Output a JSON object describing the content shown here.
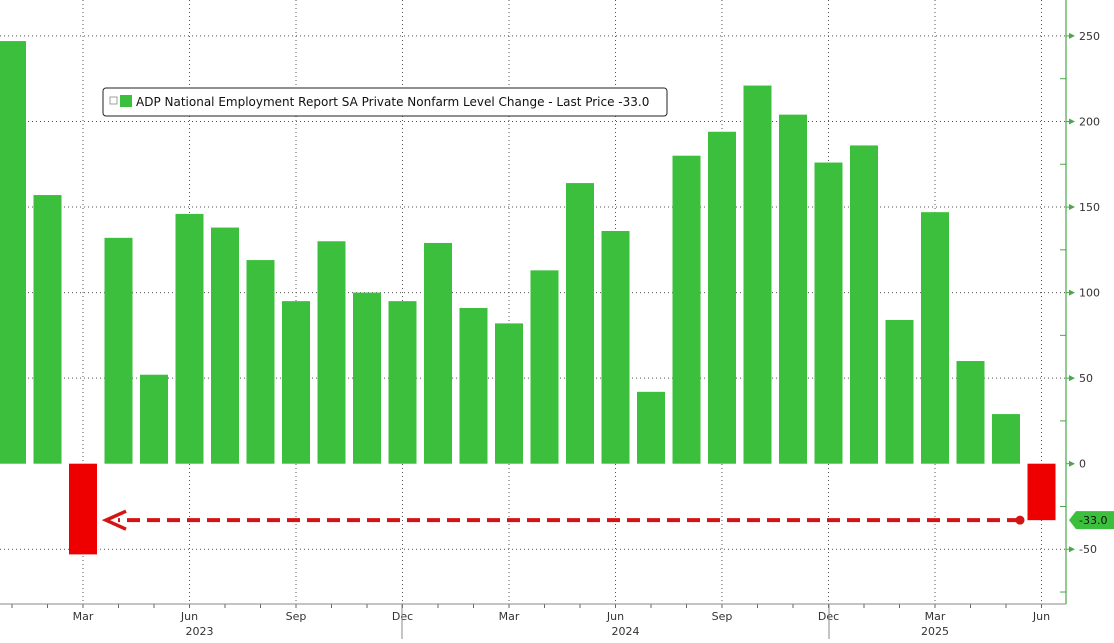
{
  "chart_data": {
    "type": "bar",
    "legend": "ADP National Employment Report SA Private Nonfarm Level Change - Last Price -33.0",
    "legend_placement": "top-left",
    "categories": [
      "Jan 2023",
      "Feb 2023",
      "Mar 2023",
      "Apr 2023",
      "May 2023",
      "Jun 2023",
      "Jul 2023",
      "Aug 2023",
      "Sep 2023",
      "Oct 2023",
      "Nov 2023",
      "Dec 2023",
      "Jan 2024",
      "Feb 2024",
      "Mar 2024",
      "Apr 2024",
      "May 2024",
      "Jun 2024",
      "Jul 2024",
      "Aug 2024",
      "Sep 2024",
      "Oct 2024",
      "Nov 2024",
      "Dec 2024",
      "Jan 2025",
      "Feb 2025",
      "Mar 2025",
      "Apr 2025",
      "May 2025",
      "Jun 2025"
    ],
    "values": [
      247,
      157,
      -53,
      132,
      52,
      146,
      138,
      119,
      95,
      130,
      100,
      95,
      129,
      91,
      82,
      113,
      164,
      136,
      42,
      180,
      194,
      221,
      204,
      176,
      186,
      84,
      147,
      60,
      29,
      -33
    ],
    "ylim": [
      -82,
      271
    ],
    "yticks": [
      -50,
      0,
      50,
      100,
      150,
      200,
      250
    ],
    "month_ticks": [
      {
        "i": 2,
        "label": "Mar"
      },
      {
        "i": 5,
        "label": "Jun"
      },
      {
        "i": 8,
        "label": "Sep"
      },
      {
        "i": 11,
        "label": "Dec"
      },
      {
        "i": 14,
        "label": "Mar"
      },
      {
        "i": 17,
        "label": "Jun"
      },
      {
        "i": 20,
        "label": "Sep"
      },
      {
        "i": 23,
        "label": "Dec"
      },
      {
        "i": 26,
        "label": "Mar"
      },
      {
        "i": 29,
        "label": "Jun"
      }
    ],
    "year_labels": [
      {
        "i": 5,
        "label": "2023"
      },
      {
        "i": 17,
        "label": "2024"
      },
      {
        "i": 26,
        "label": "2025"
      }
    ],
    "last_price_label": "-33.0",
    "grid": true,
    "colors": {
      "positive": "#3cbf3c",
      "negative": "#ee0000",
      "axis": "#4aa84a",
      "arrow": "#d41414"
    },
    "annotation": "dashed arrow from Jun 2025 level back to Mar 2023"
  }
}
